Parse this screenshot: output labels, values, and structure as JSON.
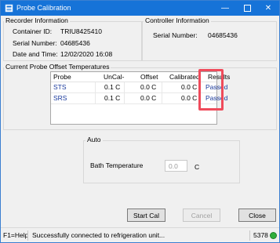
{
  "window": {
    "title": "Probe Calibration"
  },
  "recorder": {
    "group_label": "Recorder Information",
    "container_id_label": "Container ID:",
    "container_id_value": "TRIU8425410",
    "serial_label": "Serial Number:",
    "serial_value": "04685436",
    "datetime_label": "Date and Time:",
    "datetime_value": "12/02/2020 16:08"
  },
  "controller": {
    "group_label": "Controller Information",
    "serial_label": "Serial Number:",
    "serial_value": "04685436"
  },
  "probe_offsets": {
    "group_label": "Current Probe Offset Temperatures",
    "columns": [
      "Probe",
      "UnCal-",
      "Offset",
      "Calibrated",
      "Results"
    ],
    "rows": [
      {
        "probe": "STS",
        "uncal": "0.1 C",
        "offset": "0.0 C",
        "calibrated": "0.0 C",
        "result": "Passed"
      },
      {
        "probe": "SRS",
        "uncal": "0.1 C",
        "offset": "0.0 C",
        "calibrated": "0.0 C",
        "result": "Passed"
      }
    ],
    "highlight_color": "#ef4b5b"
  },
  "auto": {
    "group_label": "Auto",
    "bath_temp_label": "Bath Temperature",
    "bath_temp_value": "0.0",
    "bath_temp_unit": "C"
  },
  "buttons": {
    "start_cal": "Start Cal",
    "cancel": "Cancel",
    "close": "Close"
  },
  "status": {
    "help": "F1=Help",
    "message": "Successfully connected to refrigeration unit...",
    "code": "5378",
    "indicator_color": "#2fae3a"
  },
  "icons": {
    "app": "probe-app-icon",
    "minimize": "minimize-icon",
    "maximize": "maximize-icon",
    "close": "close-icon",
    "status": "status-indicator-icon"
  }
}
